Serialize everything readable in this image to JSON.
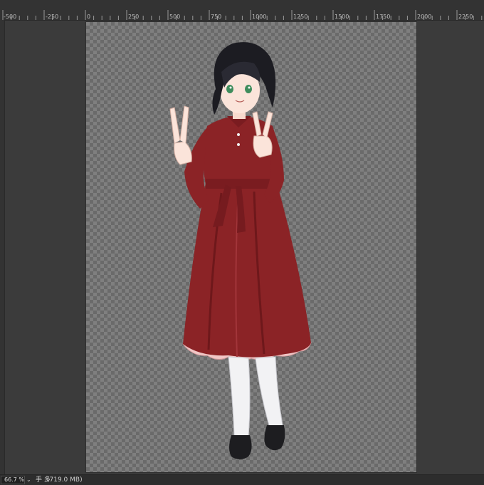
{
  "ruler": {
    "labels": [
      "-500",
      "-250",
      "0",
      "250",
      "500",
      "750",
      "1000",
      "1250",
      "1500",
      "1750",
      "2000",
      "2250"
    ]
  },
  "statusbar": {
    "zoom": "66.7 %",
    "tool": "手 多",
    "memory": "(719.0 MB)"
  },
  "colors": {
    "workspace": "#3b3b3b",
    "ruler": "#333333",
    "dress": "#8b2326",
    "hair": "#1c1c22",
    "eyes": "#3f8c5c"
  },
  "icons": {
    "zoom_dropdown": "chevron-down-icon"
  }
}
